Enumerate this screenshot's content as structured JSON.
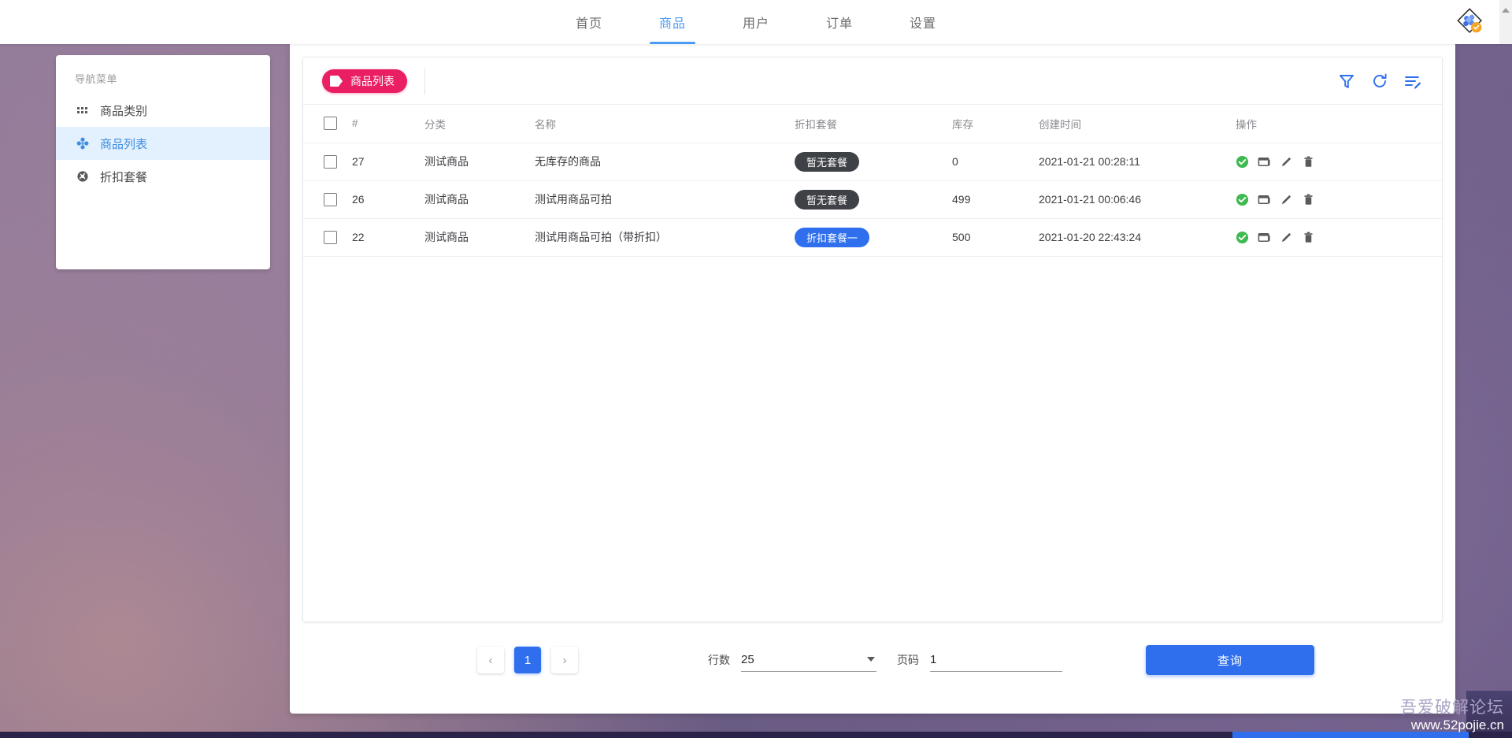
{
  "topnav": {
    "items": [
      {
        "label": "首页",
        "active": false
      },
      {
        "label": "商品",
        "active": true
      },
      {
        "label": "用户",
        "active": false
      },
      {
        "label": "订单",
        "active": false
      },
      {
        "label": "设置",
        "active": false
      }
    ],
    "logo_icon": "app-logo-icon",
    "accent_color": "#4a9cf6"
  },
  "sidebar": {
    "title": "导航菜单",
    "items": [
      {
        "label": "商品类别",
        "icon": "grid-icon",
        "active": false
      },
      {
        "label": "商品列表",
        "icon": "cluster-icon",
        "active": true
      },
      {
        "label": "折扣套餐",
        "icon": "gear-badge-icon",
        "active": false
      }
    ],
    "active_bg": "#e3f0fd",
    "active_color": "#3f8ee0"
  },
  "toolbar": {
    "tab_chip_label": "商品列表",
    "tab_chip_icon": "tag-icon",
    "tab_chip_color": "#e91e63",
    "actions": [
      {
        "name": "filter-icon",
        "title": "筛选"
      },
      {
        "name": "refresh-icon",
        "title": "刷新"
      },
      {
        "name": "list-edit-icon",
        "title": "编辑列"
      }
    ],
    "action_color": "#2f6fed"
  },
  "table": {
    "columns": [
      "",
      "#",
      "分类",
      "名称",
      "折扣套餐",
      "库存",
      "创建时间",
      "操作"
    ],
    "rows": [
      {
        "id": "27",
        "category": "测试商品",
        "name": "无库存的商品",
        "package": "暂无套餐",
        "package_type": "none",
        "stock": "0",
        "created": "2021-01-21 00:28:11"
      },
      {
        "id": "26",
        "category": "测试商品",
        "name": "测试用商品可拍",
        "package": "暂无套餐",
        "package_type": "none",
        "stock": "499",
        "created": "2021-01-21 00:06:46"
      },
      {
        "id": "22",
        "category": "测试商品",
        "name": "测试用商品可拍（带折扣）",
        "package": "折扣套餐一",
        "package_type": "pkg",
        "stock": "500",
        "created": "2021-01-20 22:43:24"
      }
    ],
    "row_actions": [
      "check-circle-icon",
      "card-icon",
      "pencil-icon",
      "trash-icon"
    ],
    "badge_none_color": "#3e4146",
    "badge_pkg_color": "#2f6fed"
  },
  "footer": {
    "prev_label": "‹",
    "next_label": "›",
    "current_page": "1",
    "rows_label": "行数",
    "rows_value": "25",
    "page_label": "页码",
    "page_value": "1",
    "query_label": "查询",
    "query_color": "#2f6fed"
  },
  "watermark": {
    "cn": "吾爱破解论坛",
    "url": "www.52pojie.cn"
  }
}
